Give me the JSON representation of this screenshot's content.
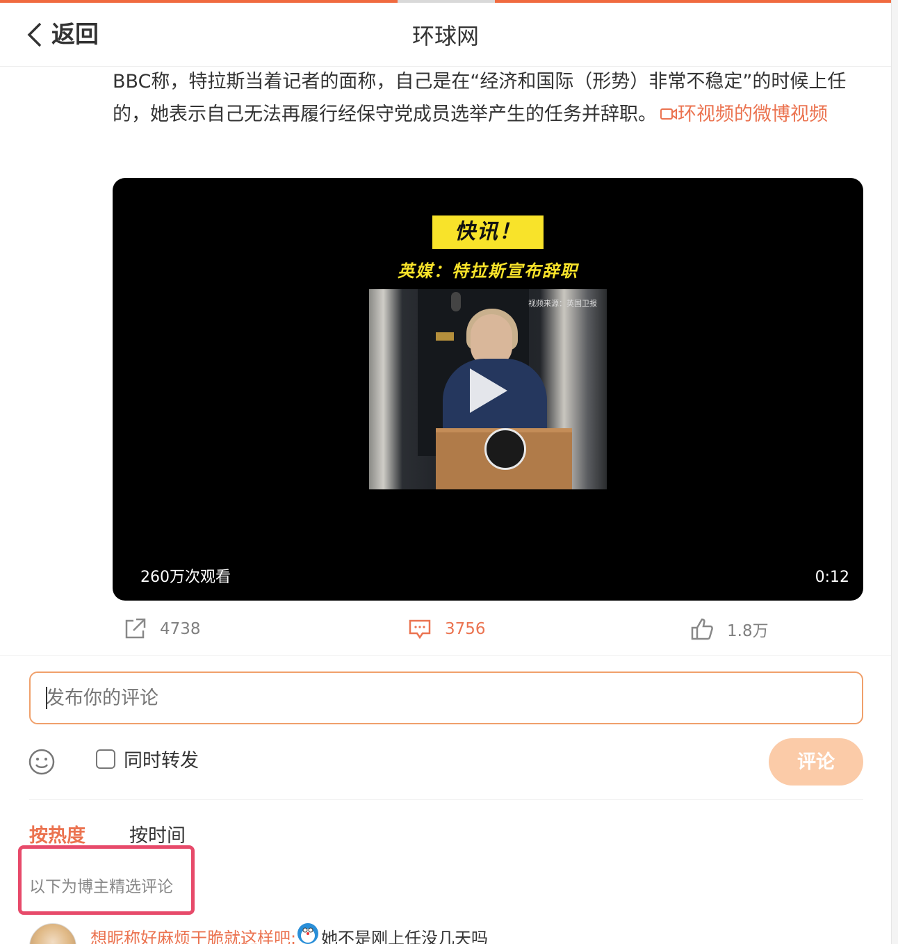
{
  "nav": {
    "back_label": "返回",
    "title": "环球网"
  },
  "post": {
    "text": "BBC称，特拉斯当着记者的面称，自己是在“经济和国际（形势）非常不稳定”的时候上任的，她表示自己无法再履行经保守党成员选举产生的任务并辞职。",
    "video_link_label": "环视频的微博视频",
    "video_link_icon": "video-camera-icon"
  },
  "video": {
    "badge": "快讯！",
    "headline": "英媒：特拉斯宣布辞职",
    "source_caption": "视频来源：英国卫报",
    "views": "260万次观看",
    "duration": "0:12"
  },
  "actions": {
    "forward_count": "4738",
    "comment_count": "3756",
    "like_count": "1.8万"
  },
  "composer": {
    "placeholder": "发布你的评论",
    "repost_label": "同时转发",
    "submit_label": "评论"
  },
  "sort": {
    "hot_label": "按热度",
    "time_label": "按时间"
  },
  "curated_note": "以下为博主精选评论",
  "first_comment": {
    "user": "想昵称好麻烦干脆就这样吧:",
    "text": "她不是刚上任没几天吗"
  },
  "colors": {
    "accent": "#eb7350",
    "highlight": "#e74a6a",
    "submit_bg": "#fbcba8"
  }
}
